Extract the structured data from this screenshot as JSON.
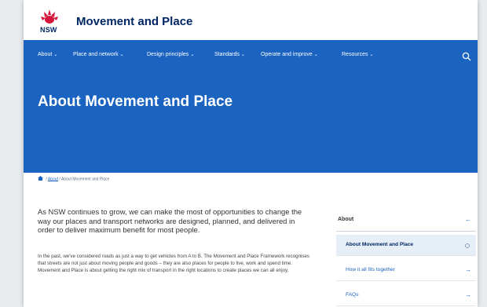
{
  "header": {
    "logo_text": "NSW",
    "site_title": "Movement and Place"
  },
  "nav": {
    "items": [
      {
        "label": "About"
      },
      {
        "label": "Place and network"
      },
      {
        "label": "Design principles"
      },
      {
        "label": "Standards"
      },
      {
        "label": "Operate and improve"
      },
      {
        "label": "Resources"
      }
    ],
    "search_icon": "search-icon"
  },
  "hero": {
    "title": "About Movement and Place"
  },
  "breadcrumb": {
    "home_icon": "home-icon",
    "parent": "About",
    "current": "About Movement and Place"
  },
  "main": {
    "intro": "As NSW continues to grow, we can make the most of opportunities to change the way our places and transport networks are designed, planned, and delivered in order to deliver maximum benefit for most people.",
    "body": "In the past, we've considered roads as just a way to get vehicles from A to B. The Movement and Place Framework recognises that streets are not just about moving people and goods – they are also places for people to live, work and spend time. Movement and Place is about getting the right mix of transport in the right locations to create places we can all enjoy."
  },
  "side_nav": {
    "heading": "About",
    "items": [
      {
        "label": "About Movement and Place",
        "active": true
      },
      {
        "label": "How it all fits together",
        "active": false
      },
      {
        "label": "FAQs",
        "active": false
      }
    ]
  },
  "colors": {
    "brand_navy": "#002664",
    "nav_blue": "#1a63c0",
    "waratah_red": "#d7153a"
  }
}
